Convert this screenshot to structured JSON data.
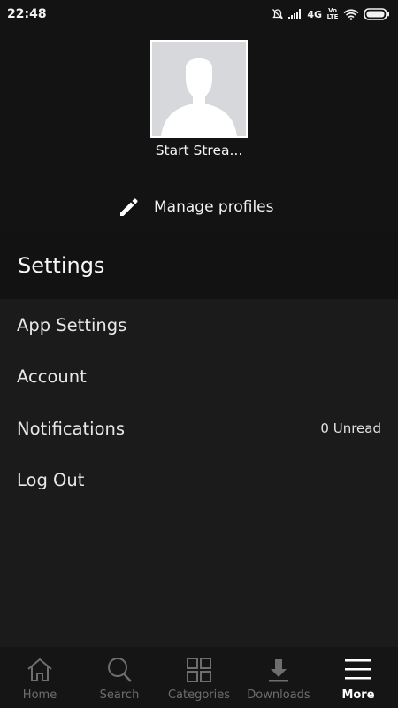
{
  "status_bar": {
    "time": "22:48",
    "network": "4G",
    "volte_label": "Vo LTE",
    "icons": [
      "alarm-off-icon",
      "signal-icon",
      "wifi-icon",
      "battery-icon"
    ]
  },
  "profile": {
    "name": "Start Strea...",
    "avatar_icon": "person-silhouette-icon",
    "manage_icon": "pencil-icon",
    "manage_label": "Manage profiles"
  },
  "settings": {
    "title": "Settings",
    "items": [
      {
        "label": "App Settings",
        "meta": ""
      },
      {
        "label": "Account",
        "meta": ""
      },
      {
        "label": "Notifications",
        "meta": "0 Unread"
      },
      {
        "label": "Log Out",
        "meta": ""
      }
    ]
  },
  "nav": {
    "active": "More",
    "items": [
      {
        "label": "Home",
        "icon": "home-icon"
      },
      {
        "label": "Search",
        "icon": "search-icon"
      },
      {
        "label": "Categories",
        "icon": "grid-icon"
      },
      {
        "label": "Downloads",
        "icon": "download-icon"
      },
      {
        "label": "More",
        "icon": "menu-icon"
      }
    ]
  },
  "colors": {
    "background": "#1b1b1b",
    "header_background": "#131313",
    "text_primary": "#e8e8e8",
    "nav_inactive": "#6e6e6e",
    "nav_active": "#ffffff"
  }
}
